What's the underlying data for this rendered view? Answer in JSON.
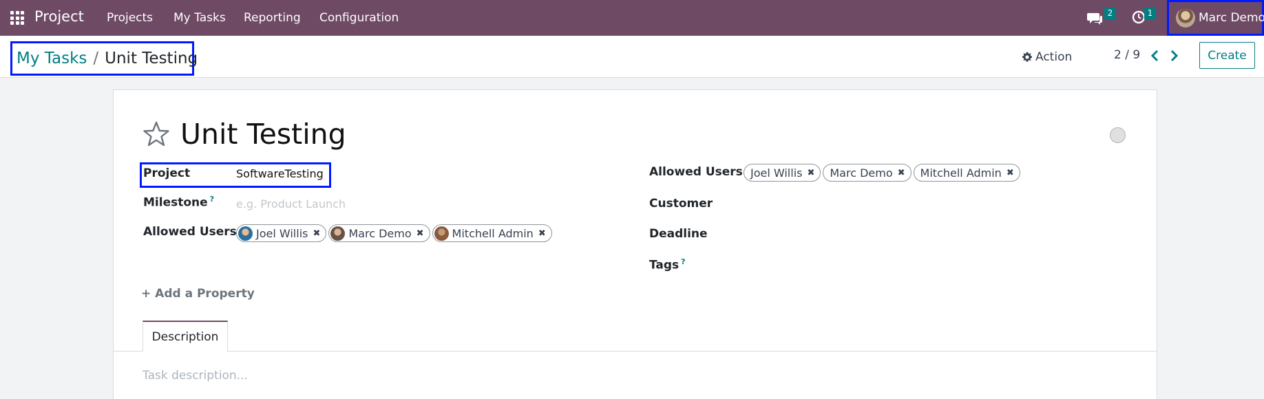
{
  "navbar": {
    "brand": "Project",
    "menu": [
      "Projects",
      "My Tasks",
      "Reporting",
      "Configuration"
    ],
    "messages_count": "2",
    "activities_count": "1",
    "user_name": "Marc Demo",
    "bg_color": "#6f4a65"
  },
  "control_panel": {
    "breadcrumb_parent": "My Tasks",
    "breadcrumb_separator": "/",
    "breadcrumb_current": "Unit Testing",
    "action_label": "Action",
    "pager": "2 / 9",
    "create_label": "Create"
  },
  "form": {
    "title": "Unit Testing",
    "left": {
      "project_label": "Project",
      "project_value": "SoftwareTesting",
      "milestone_label": "Milestone",
      "milestone_help": "?",
      "milestone_placeholder": "e.g. Product Launch",
      "allowed_users_label": "Allowed Users",
      "allowed_users": [
        "Joel Willis",
        "Marc Demo",
        "Mitchell Admin"
      ]
    },
    "right": {
      "allowed_users_label": "Allowed Users",
      "allowed_users": [
        "Joel Willis",
        "Marc Demo",
        "Mitchell Admin"
      ],
      "customer_label": "Customer",
      "deadline_label": "Deadline",
      "tags_label": "Tags",
      "tags_help": "?"
    },
    "add_property": "Add a Property",
    "tab_description": "Description",
    "description_placeholder": "Task description..."
  },
  "accent_color": "#017e84"
}
